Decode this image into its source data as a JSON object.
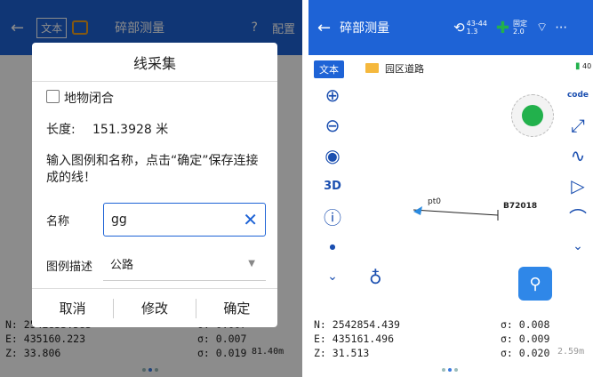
{
  "left": {
    "topbar": {
      "back": "←",
      "text_mode": "文本",
      "title": "碎部测量",
      "help": "?",
      "config": "配置"
    },
    "dialog": {
      "title": "线采集",
      "closed_label": "地物闭合",
      "length_label": "长度:",
      "length_value": "151.3928 米",
      "instruction": "输入图例和名称，点击“确定”保存连接成的线！",
      "name_label": "名称",
      "name_value": "gg",
      "legend_label": "图例描述",
      "legend_value": "公路",
      "cancel": "取消",
      "modify": "修改",
      "ok": "确定"
    },
    "coords": {
      "n": "N: 2542853.583",
      "e": "E: 435160.223",
      "z": "Z: 33.806",
      "sn": "σ: 0.007",
      "se": "σ: 0.007",
      "sz": "σ: 0.019",
      "scale": "81.40m"
    }
  },
  "right": {
    "topbar": {
      "back": "←",
      "title": "碎部测量",
      "sat_top": "43-44",
      "sat_bottom": "1.3",
      "fix_top": "固定",
      "fix_bottom": "2.0"
    },
    "map": {
      "text_mode": "文本",
      "folder": "园区道路",
      "battery": "40",
      "point1": "pt0",
      "point2": "B72018",
      "code_label": "code"
    },
    "coords": {
      "n": "N: 2542854.439",
      "e": "E: 435161.496",
      "z": "Z: 31.513",
      "sn": "σ: 0.008",
      "se": "σ: 0.009",
      "sz": "σ: 0.020",
      "scale": "2.59m"
    }
  },
  "colors": {
    "accent": "#1e63d6",
    "gnss_fix": "#22b14c"
  }
}
